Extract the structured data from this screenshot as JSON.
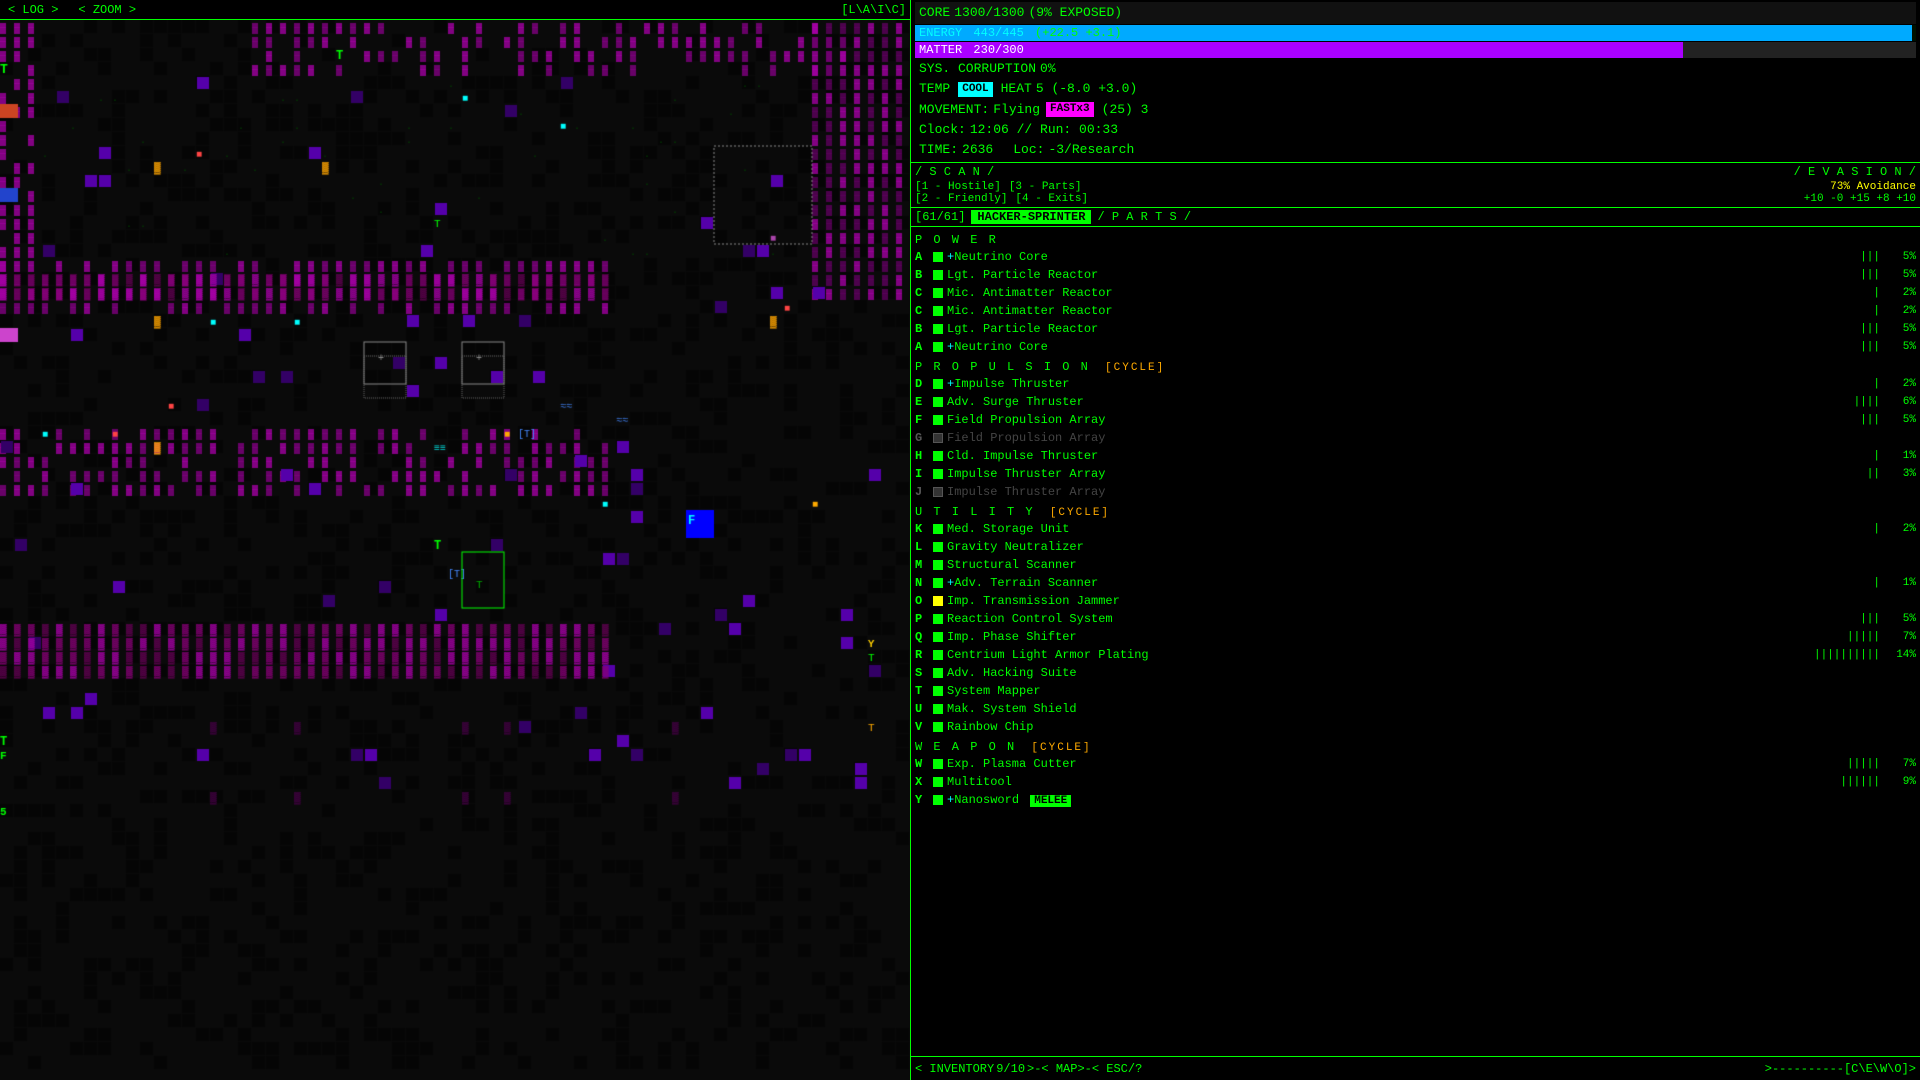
{
  "topbar": {
    "log": "< LOG >",
    "zoom": "< ZOOM >",
    "laric": "[L\\A\\I\\C]"
  },
  "status": {
    "core_label": "CORE",
    "core_value": "1300/1300",
    "core_exposed": "(9% EXPOSED)",
    "energy_label": "ENERGY",
    "energy_value": "443/445",
    "energy_regen": "(+22.5 +3.1)",
    "energy_pct": 99.6,
    "matter_label": "MATTER",
    "matter_value": "230/300",
    "matter_pct": 76.7,
    "sys_label": "SYS. CORRUPTION",
    "sys_value": "0%",
    "temp_label": "TEMP",
    "temp_badge": "COOL",
    "heat_label": "HEAT",
    "heat_value": "5 (-8.0 +3.0)",
    "movement_label": "MOVEMENT:",
    "movement_type": "Flying",
    "movement_badge": "FASTx3",
    "movement_val": "(25) 3",
    "clock_label": "Clock:",
    "clock_value": "12:06 // Run: 00:33",
    "time_label": "TIME:",
    "time_value": "2636",
    "loc_label": "Loc:",
    "loc_value": "-3/Research"
  },
  "scan": {
    "header": "/ S C A N /",
    "item1": "[1 - Hostile]",
    "item2": "[2 - Friendly]",
    "item3": "[3 - Parts]",
    "item4": "[4 - Exits]"
  },
  "evasion": {
    "header": "/ E V A S I O N /",
    "pct": "73% Avoidance",
    "mods": "+10 -0 +15 +8 +10"
  },
  "parts_header": {
    "slots": "61/61",
    "build_label": "HACKER-SPRINTER",
    "parts_label": "/ P A R T S /"
  },
  "categories": {
    "power": {
      "label": "P O W E R",
      "items": [
        {
          "key": "A",
          "active": true,
          "indicator": "green",
          "name": "+Neutrino Core",
          "bars": "|||",
          "pct": "5%"
        },
        {
          "key": "B",
          "active": true,
          "indicator": "green",
          "name": "Lgt. Particle Reactor",
          "bars": "|||",
          "pct": "5%"
        },
        {
          "key": "C",
          "active": true,
          "indicator": "green",
          "name": "Mic. Antimatter Reactor",
          "bars": "|",
          "pct": "2%"
        }
      ]
    },
    "propulsion": {
      "label": "P R O P U L S I O N",
      "cycle": "[CYCLE]",
      "items": [
        {
          "key": "D",
          "active": true,
          "indicator": "green",
          "name": "+Impulse Thruster",
          "bars": "|",
          "pct": "2%"
        },
        {
          "key": "E",
          "active": true,
          "indicator": "green",
          "name": "Adv. Surge Thruster",
          "bars": "||||",
          "pct": "6%"
        },
        {
          "key": "F",
          "active": true,
          "indicator": "green",
          "name": "Field Propulsion Array",
          "bars": "|||",
          "pct": "5%"
        },
        {
          "key": "G",
          "active": false,
          "indicator": "inactive",
          "name": "Field Propulsion Array",
          "bars": "",
          "pct": ""
        },
        {
          "key": "H",
          "active": true,
          "indicator": "green",
          "name": "Cld. Impulse Thruster",
          "bars": "|",
          "pct": "1%"
        },
        {
          "key": "I",
          "active": true,
          "indicator": "green",
          "name": "Impulse Thruster Array",
          "bars": "||",
          "pct": "3%"
        },
        {
          "key": "J",
          "active": false,
          "indicator": "inactive",
          "name": "Impulse Thruster Array",
          "bars": "",
          "pct": ""
        }
      ]
    },
    "utility": {
      "label": "U T I L I T Y",
      "cycle": "[CYCLE]",
      "items": [
        {
          "key": "K",
          "active": true,
          "indicator": "green",
          "name": "Med. Storage Unit",
          "bars": "|",
          "pct": "2%"
        },
        {
          "key": "L",
          "active": true,
          "indicator": "green",
          "name": "Gravity Neutralizer",
          "bars": "",
          "pct": ""
        },
        {
          "key": "M",
          "active": true,
          "indicator": "green",
          "name": "Structural Scanner",
          "bars": "",
          "pct": ""
        },
        {
          "key": "N",
          "active": true,
          "indicator": "green",
          "name": "+Adv. Terrain Scanner",
          "bars": "|",
          "pct": "1%"
        },
        {
          "key": "O",
          "active": true,
          "indicator": "yellow",
          "name": "Imp. Transmission Jammer",
          "bars": "",
          "pct": ""
        },
        {
          "key": "P",
          "active": true,
          "indicator": "green",
          "name": "Reaction Control System",
          "bars": "|||",
          "pct": "5%"
        },
        {
          "key": "Q",
          "active": true,
          "indicator": "green",
          "name": "Imp. Phase Shifter",
          "bars": "|||||",
          "pct": "7%"
        },
        {
          "key": "R",
          "active": true,
          "indicator": "green",
          "name": "Centrium Light Armor Plating",
          "bars": "||||||||||",
          "pct": "14%"
        },
        {
          "key": "S",
          "active": true,
          "indicator": "green",
          "name": "Adv. Hacking Suite",
          "bars": "",
          "pct": ""
        },
        {
          "key": "T",
          "active": true,
          "indicator": "green",
          "name": "System Mapper",
          "bars": "",
          "pct": ""
        },
        {
          "key": "U",
          "active": true,
          "indicator": "green",
          "name": "Mak. System Shield",
          "bars": "",
          "pct": ""
        },
        {
          "key": "V",
          "active": true,
          "indicator": "green",
          "name": "Rainbow Chip",
          "bars": "",
          "pct": ""
        }
      ]
    },
    "weapon": {
      "label": "W E A P O N",
      "cycle": "[CYCLE]",
      "items": [
        {
          "key": "W",
          "active": true,
          "indicator": "green",
          "name": "Exp. Plasma Cutter",
          "bars": "|||||",
          "pct": "7%"
        },
        {
          "key": "X",
          "active": true,
          "indicator": "green",
          "name": "Multitool",
          "bars": "||||||",
          "pct": "9%"
        },
        {
          "key": "Y",
          "active": true,
          "indicator": "green",
          "name": "+Nanosword",
          "badge": "MELEE",
          "bars": "",
          "pct": ""
        }
      ]
    }
  },
  "bottom_bar": {
    "inventory": "< INVENTORY",
    "inv_val": "9/10",
    "map": ">-< MAP",
    "esc": ">-< ESC/?",
    "keys": ">----------[C\\E\\W\\O]>"
  },
  "game_top": {
    "log": "< LOG >",
    "zoom": "< ZOOM >",
    "laric": "[L\\A\\I\\C]"
  }
}
